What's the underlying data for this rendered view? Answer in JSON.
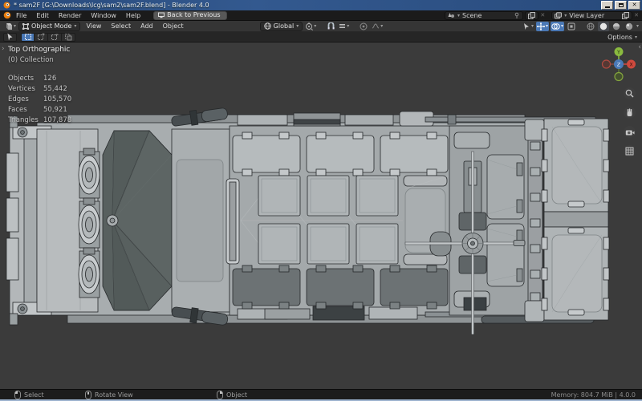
{
  "window": {
    "title": "* sam2F [G:\\Downloads\\lcg\\sam2\\sam2F.blend] - Blender 4.0"
  },
  "topbar": {
    "menus": [
      "File",
      "Edit",
      "Render",
      "Window",
      "Help"
    ],
    "back_label": "Back to Previous",
    "scene_label": "Scene",
    "view_layer_label": "View Layer"
  },
  "viewport_header": {
    "mode_label": "Object Mode",
    "menus": [
      "View",
      "Select",
      "Add",
      "Object"
    ],
    "orientation_label": "Global",
    "options_label": "Options"
  },
  "viewport": {
    "view_label": "Top Orthographic",
    "collection_label": "(0) Collection",
    "stats": [
      {
        "label": "Objects",
        "value": "126"
      },
      {
        "label": "Vertices",
        "value": "55,442"
      },
      {
        "label": "Edges",
        "value": "105,570"
      },
      {
        "label": "Faces",
        "value": "50,921"
      },
      {
        "label": "Triangles",
        "value": "107,878"
      }
    ],
    "gizmo": {
      "x": "X",
      "y": "Y",
      "z": "Z"
    }
  },
  "statusbar": {
    "keymap": [
      {
        "icon": "mouse-left-icon",
        "label": "Select"
      },
      {
        "icon": "mouse-middle-icon",
        "label": "Rotate View"
      },
      {
        "icon": "mouse-right-icon",
        "label": "Object"
      }
    ],
    "memory": "Memory: 804.7 MiB  |  4.0.0"
  },
  "colors": {
    "accent_blue": "#4a78b5",
    "titlebar_blue": "#2d5186",
    "viewport_bg": "#3b3b3b",
    "model_light": "#b4b8ba",
    "windshield_dark": "#58605f",
    "blender_orange": "#e87d0d"
  }
}
